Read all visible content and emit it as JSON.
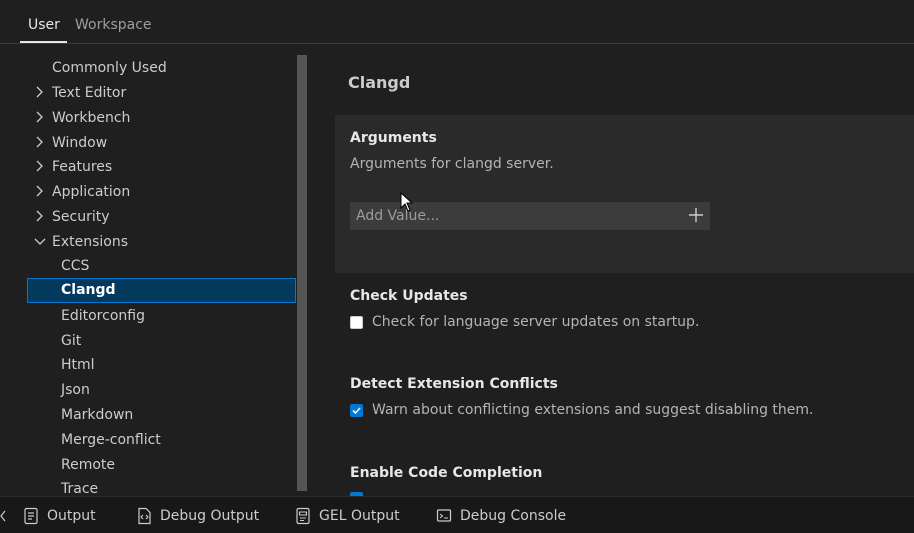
{
  "tabs": [
    {
      "label": "User",
      "active": true
    },
    {
      "label": "Workspace",
      "active": false
    }
  ],
  "tree": {
    "items": [
      {
        "label": "Commonly Used",
        "chevron": "none"
      },
      {
        "label": "Text Editor",
        "chevron": "chevron-right"
      },
      {
        "label": "Workbench",
        "chevron": "chevron-right"
      },
      {
        "label": "Window",
        "chevron": "chevron-right"
      },
      {
        "label": "Features",
        "chevron": "chevron-right"
      },
      {
        "label": "Application",
        "chevron": "chevron-right"
      },
      {
        "label": "Security",
        "chevron": "chevron-right"
      },
      {
        "label": "Extensions",
        "chevron": "chevron-down"
      },
      {
        "label": "CCS"
      },
      {
        "label": "Clangd",
        "selected": true
      },
      {
        "label": "Editorconfig"
      },
      {
        "label": "Git"
      },
      {
        "label": "Html"
      },
      {
        "label": "Json"
      },
      {
        "label": "Markdown"
      },
      {
        "label": "Merge-conflict"
      },
      {
        "label": "Remote"
      },
      {
        "label": "Trace"
      }
    ]
  },
  "content": {
    "section_title": "Clangd",
    "arguments": {
      "title": "Arguments",
      "description": "Arguments for clangd server.",
      "add_placeholder": "Add Value...",
      "add_icon": "plus-icon"
    },
    "check_updates": {
      "title": "Check Updates",
      "label": "Check for language server updates on startup.",
      "checked": false
    },
    "detect_conflicts": {
      "title": "Detect Extension Conflicts",
      "label": "Warn about conflicting extensions and suggest disabling them.",
      "checked": true
    },
    "code_completion": {
      "title": "Enable Code Completion"
    }
  },
  "panel": {
    "tabs": [
      {
        "label": "Output",
        "icon": "output-icon"
      },
      {
        "label": "Debug Output",
        "icon": "debug-output-icon"
      },
      {
        "label": "GEL Output",
        "icon": "gel-output-icon"
      },
      {
        "label": "Debug Console",
        "icon": "debug-console-icon"
      }
    ]
  },
  "colors": {
    "accent": "#0078d4",
    "selection_bg": "#04395e",
    "background": "#1f1f1f"
  }
}
